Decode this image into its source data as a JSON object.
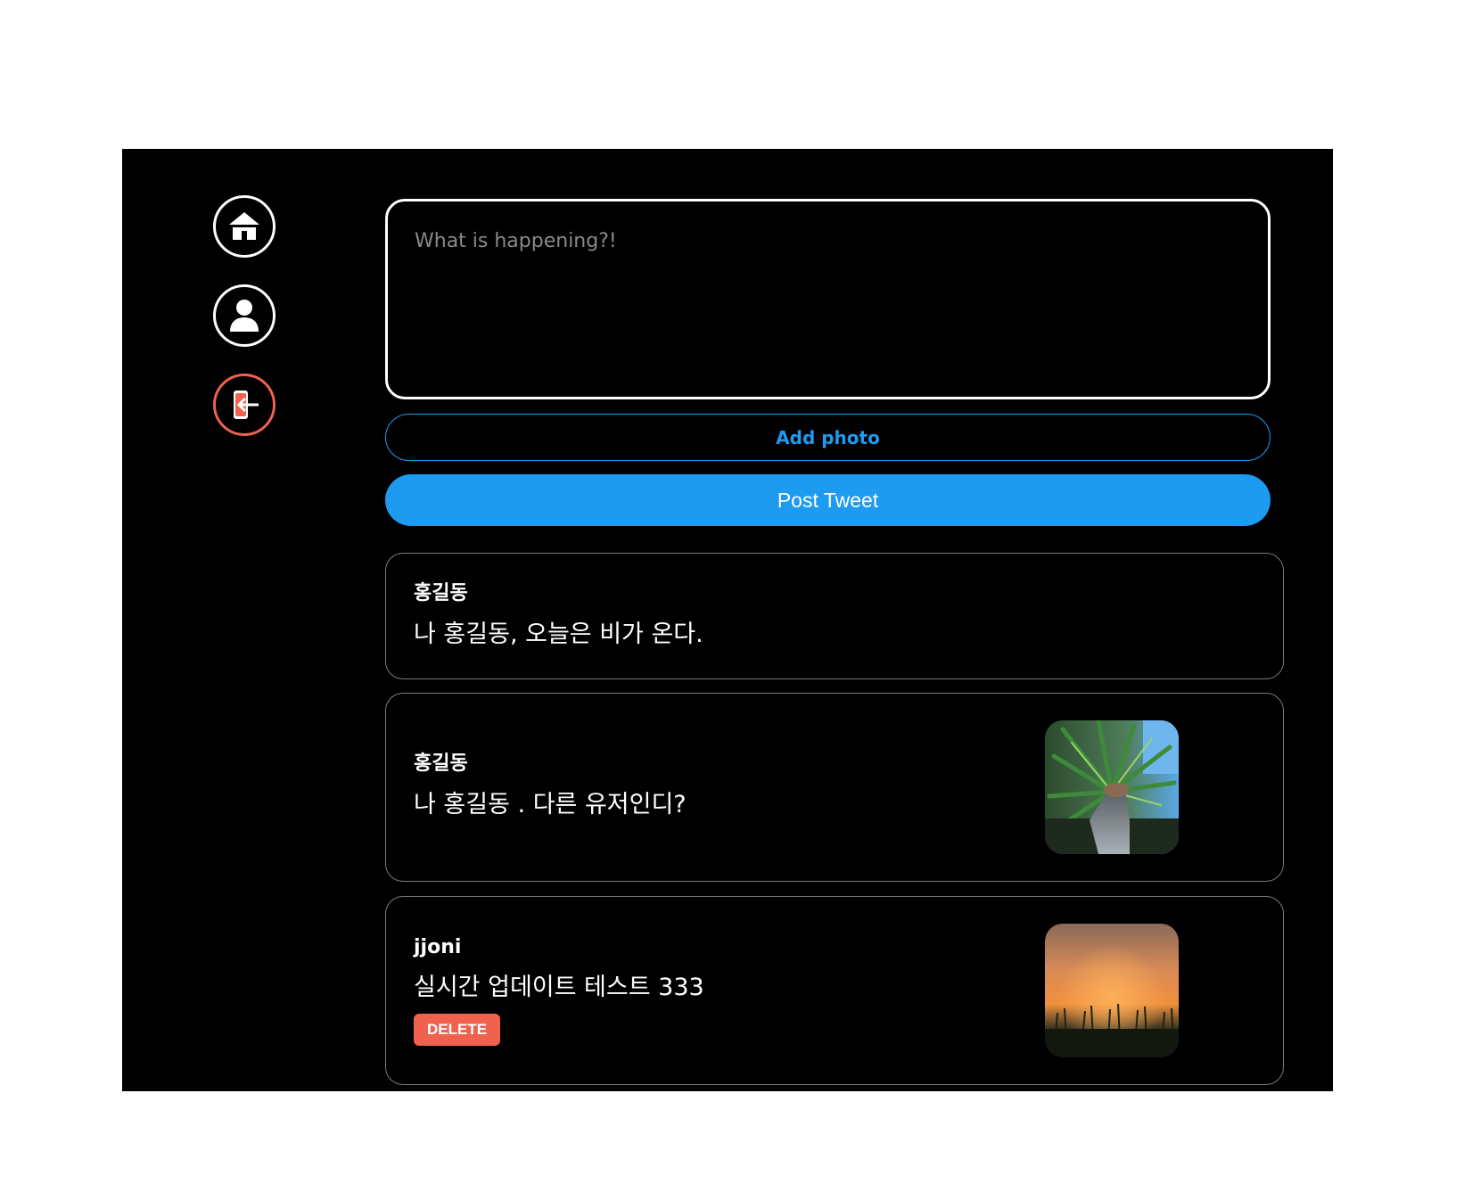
{
  "nav": {
    "items": [
      {
        "name": "home",
        "icon": "home-icon"
      },
      {
        "name": "profile",
        "icon": "user-icon"
      },
      {
        "name": "logout",
        "icon": "logout-icon"
      }
    ],
    "logout_color": "#f0614e"
  },
  "composer": {
    "placeholder": "What is happening?!",
    "add_photo_label": "Add photo",
    "post_label": "Post Tweet"
  },
  "colors": {
    "accent": "#1d9bf0",
    "danger": "#f0614e",
    "background": "#000000"
  },
  "tweets": [
    {
      "username": "홍길동",
      "text": "나 홍길동, 오늘은 비가 온다.",
      "has_photo": false,
      "photo_desc": ""
    },
    {
      "username": "홍길동",
      "text": "나 홍길동 . 다른 유저인디?",
      "has_photo": true,
      "photo_desc": "palm-leaves-photo"
    },
    {
      "username": "jjoni",
      "text": "실시간 업데이트 테스트 333",
      "has_photo": true,
      "photo_desc": "sunset-grass-photo",
      "delete_label": "DELETE"
    }
  ]
}
